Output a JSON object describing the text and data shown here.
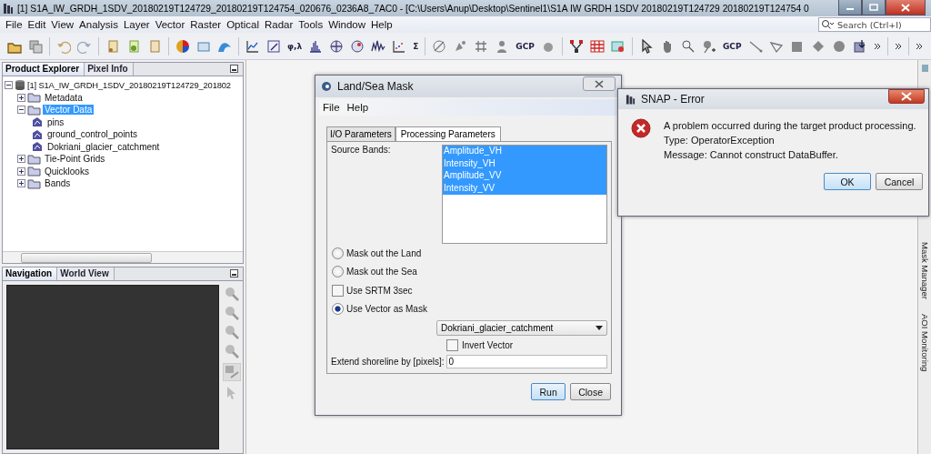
{
  "window": {
    "title": "[1] S1A_IW_GRDH_1SDV_20180219T124729_20180219T124754_020676_0236A8_7AC0 - [C:\\Users\\Anup\\Desktop\\Sentinel1\\S1A IW GRDH 1SDV 20180219T124729 20180219T124754 0"
  },
  "menu": [
    "File",
    "Edit",
    "View",
    "Analysis",
    "Layer",
    "Vector",
    "Raster",
    "Optical",
    "Radar",
    "Tools",
    "Window",
    "Help"
  ],
  "search": {
    "placeholder": "Search (Ctrl+I)"
  },
  "toolbar": {
    "texts": [
      "φ,λ",
      "Σ",
      "GCP",
      "GCP"
    ]
  },
  "explorer": {
    "tabs": [
      {
        "label": "Product Explorer",
        "selected": true
      },
      {
        "label": "Pixel Info",
        "selected": false
      }
    ],
    "tree": [
      {
        "label": "[1] S1A_IW_GRDH_1SDV_20180219T124729_201802",
        "kind": "product",
        "expanded": true,
        "selected": false,
        "children": [
          {
            "label": "Metadata",
            "kind": "folder",
            "expanded": false,
            "selected": false
          },
          {
            "label": "Vector Data",
            "kind": "folder",
            "expanded": true,
            "selected": true,
            "children": [
              {
                "label": "pins",
                "kind": "vector",
                "selected": false
              },
              {
                "label": "ground_control_points",
                "kind": "vector",
                "selected": false
              },
              {
                "label": "Dokriani_glacier_catchment",
                "kind": "vector",
                "selected": false
              }
            ]
          },
          {
            "label": "Tie-Point Grids",
            "kind": "folder",
            "expanded": false,
            "selected": false
          },
          {
            "label": "Quicklooks",
            "kind": "folder",
            "expanded": false,
            "selected": false
          },
          {
            "label": "Bands",
            "kind": "folder",
            "expanded": false,
            "selected": false
          }
        ]
      }
    ]
  },
  "navigation": {
    "tabs": [
      {
        "label": "Navigation",
        "selected": true
      },
      {
        "label": "World View",
        "selected": false
      }
    ]
  },
  "right_tabs": [
    "Mask Manager",
    "AOI Monitoring"
  ],
  "dialog": {
    "title": "Land/Sea Mask",
    "menu": [
      "File",
      "Help"
    ],
    "tabs": [
      {
        "label": "I/O Parameters",
        "selected": false
      },
      {
        "label": "Processing Parameters",
        "selected": true
      }
    ],
    "source_bands_label": "Source Bands:",
    "bands": [
      {
        "label": "Amplitude_VH",
        "selected": true
      },
      {
        "label": "Intensity_VH",
        "selected": true
      },
      {
        "label": "Amplitude_VV",
        "selected": true
      },
      {
        "label": "Intensity_VV",
        "selected": true
      }
    ],
    "options": [
      {
        "kind": "radio",
        "label": "Mask out the Land",
        "checked": false
      },
      {
        "kind": "radio",
        "label": "Mask out the Sea",
        "checked": false
      },
      {
        "kind": "checkbox",
        "label": "Use SRTM 3sec",
        "checked": false
      },
      {
        "kind": "radio",
        "label": "Use Vector as Mask",
        "checked": true
      }
    ],
    "vector_dropdown": "Dokriani_glacier_catchment",
    "invert_vector": {
      "label": "Invert Vector",
      "checked": false
    },
    "shoreline": {
      "label": "Extend shoreline by [pixels]:",
      "value": "0"
    },
    "buttons": [
      {
        "label": "Run",
        "focused": true
      },
      {
        "label": "Close",
        "focused": false
      }
    ]
  },
  "error": {
    "title": "SNAP - Error",
    "lines": [
      "A problem occurred during the target product processing.",
      "Type: OperatorException",
      "Message: Cannot construct DataBuffer."
    ],
    "buttons": [
      {
        "label": "OK",
        "focused": true
      },
      {
        "label": "Cancel",
        "focused": false
      }
    ]
  }
}
